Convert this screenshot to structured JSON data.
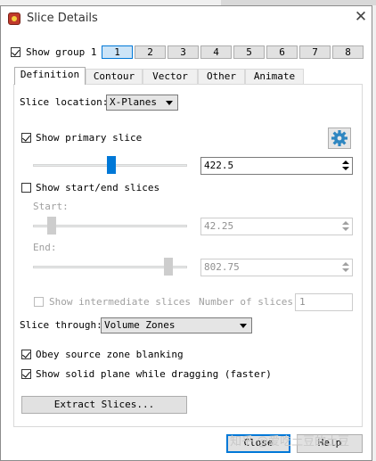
{
  "window": {
    "title": "Slice Details"
  },
  "group": {
    "show_label": "Show group 1",
    "show_checked": true,
    "buttons": [
      "1",
      "2",
      "3",
      "4",
      "5",
      "6",
      "7",
      "8"
    ],
    "selected": "1"
  },
  "tabs": [
    "Definition",
    "Contour",
    "Vector",
    "Other",
    "Animate"
  ],
  "active_tab": "Definition",
  "definition": {
    "location_label": "Slice location:",
    "location_value": "X-Planes",
    "primary_label": "Show primary slice",
    "primary_checked": true,
    "primary_value": "422.5",
    "primary_slider_fraction": 0.51,
    "startend_label": "Show start/end slices",
    "startend_checked": false,
    "start_label": "Start:",
    "start_value": "42.25",
    "start_slider_fraction": 0.1,
    "end_label": "End:",
    "end_value": "802.75",
    "end_slider_fraction": 0.9,
    "intermediate_label": "Show intermediate slices",
    "intermediate_checked": false,
    "num_slices_label": "Number of slices:",
    "num_slices_value": "1",
    "through_label": "Slice through:",
    "through_value": "Volume Zones",
    "obey_label": "Obey source zone blanking",
    "obey_checked": true,
    "solid_label": "Show solid plane while dragging (faster)",
    "solid_checked": true,
    "extract_label": "Extract Slices..."
  },
  "footer": {
    "close_label": "Close",
    "help_label": "Help"
  },
  "watermark": "知乎 @爱吃土豆的土豆",
  "icons": {
    "app": "tecplot-app-icon",
    "gear": "gear-icon",
    "close": "close-icon"
  },
  "colors": {
    "accent": "#0078d7",
    "disabled": "#a0a0a0"
  }
}
